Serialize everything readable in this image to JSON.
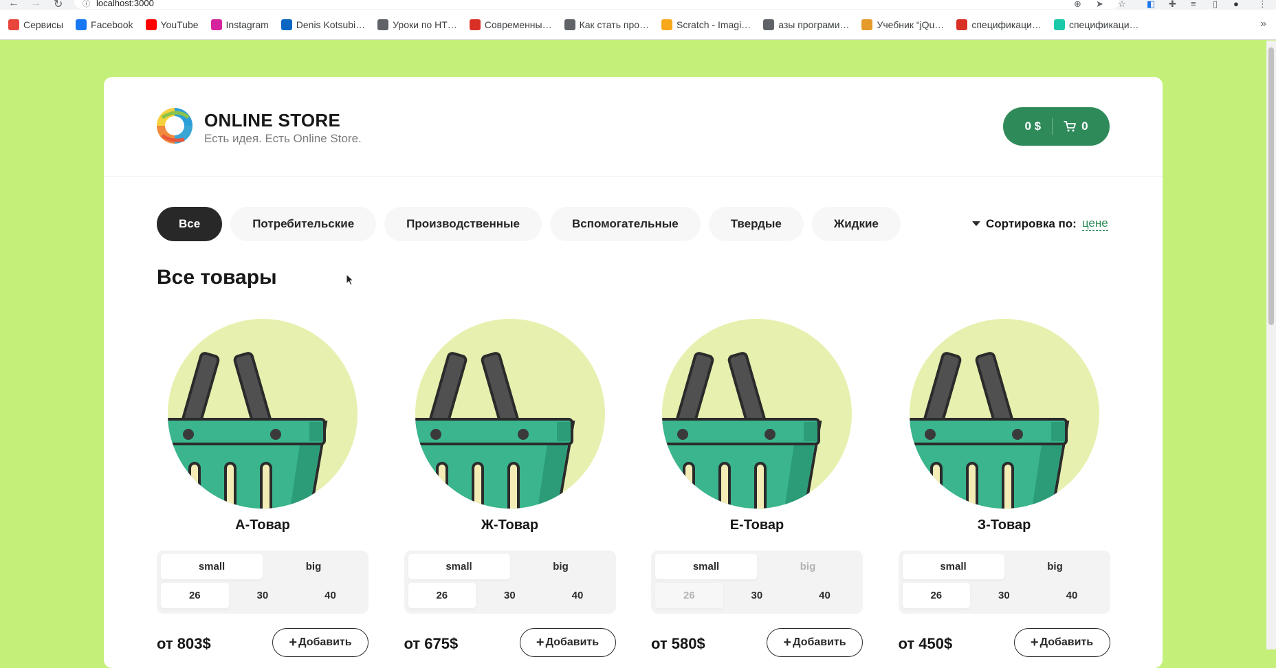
{
  "browser": {
    "url": "localhost:3000",
    "bookmarks": [
      {
        "label": "Сервисы",
        "icon": "apps-grid-icon",
        "color": "#e8453c"
      },
      {
        "label": "Facebook",
        "icon": "facebook-icon",
        "color": "#1877f2"
      },
      {
        "label": "YouTube",
        "icon": "youtube-icon",
        "color": "#ff0000"
      },
      {
        "label": "Instagram",
        "icon": "instagram-icon",
        "color": "#d6249f"
      },
      {
        "label": "Denis Kotsubi…",
        "icon": "linkedin-icon",
        "color": "#0a66c2"
      },
      {
        "label": "Уроки по HT…",
        "icon": "chat-icon",
        "color": "#5f6368"
      },
      {
        "label": "Современны…",
        "icon": "mobile-icon",
        "color": "#d93025"
      },
      {
        "label": "Как стать про…",
        "icon": "globe-icon",
        "color": "#5f6368"
      },
      {
        "label": "Scratch - Imagi…",
        "icon": "scratch-icon",
        "color": "#f7a81b"
      },
      {
        "label": "азы програми…",
        "icon": "globe-icon",
        "color": "#5f6368"
      },
      {
        "label": "Учебник “jQu…",
        "icon": "jquery-icon",
        "color": "#e49b2a"
      },
      {
        "label": "спецификаци…",
        "icon": "cube-icon",
        "color": "#d93025"
      },
      {
        "label": "спецификаци…",
        "icon": "bookmark-icon",
        "color": "#1bc9a8"
      }
    ]
  },
  "store": {
    "name": "ONLINE STORE",
    "tagline": "Есть идея. Есть Online Store.",
    "cart_total": "0 $",
    "cart_count": "0"
  },
  "categories": [
    {
      "label": "Все",
      "active": true
    },
    {
      "label": "Потребительские",
      "active": false
    },
    {
      "label": "Производственные",
      "active": false
    },
    {
      "label": "Вспомогательные",
      "active": false
    },
    {
      "label": "Твердые",
      "active": false
    },
    {
      "label": "Жидкие",
      "active": false
    }
  ],
  "sort": {
    "label": "Сортировка по:",
    "value": "цене"
  },
  "page_title": "Все товары",
  "add_label": "Добавить",
  "colors": {
    "background": "#c4f07a",
    "accent": "#2f8a5a",
    "dark": "#282828"
  },
  "products": [
    {
      "name": "А-Товар",
      "price": "от 803$",
      "types": [
        {
          "label": "small",
          "state": "selected"
        },
        {
          "label": "big",
          "state": "normal"
        }
      ],
      "sizes": [
        {
          "label": "26",
          "state": "selected"
        },
        {
          "label": "30",
          "state": "normal"
        },
        {
          "label": "40",
          "state": "normal"
        }
      ]
    },
    {
      "name": "Ж-Товар",
      "price": "от 675$",
      "types": [
        {
          "label": "small",
          "state": "selected"
        },
        {
          "label": "big",
          "state": "normal"
        }
      ],
      "sizes": [
        {
          "label": "26",
          "state": "selected"
        },
        {
          "label": "30",
          "state": "normal"
        },
        {
          "label": "40",
          "state": "normal"
        }
      ]
    },
    {
      "name": "Е-Товар",
      "price": "от 580$",
      "types": [
        {
          "label": "small",
          "state": "selected"
        },
        {
          "label": "big",
          "state": "disabled"
        }
      ],
      "sizes": [
        {
          "label": "26",
          "state": "disabled-selected"
        },
        {
          "label": "30",
          "state": "normal"
        },
        {
          "label": "40",
          "state": "normal"
        }
      ]
    },
    {
      "name": "З-Товар",
      "price": "от 450$",
      "types": [
        {
          "label": "small",
          "state": "selected"
        },
        {
          "label": "big",
          "state": "normal"
        }
      ],
      "sizes": [
        {
          "label": "26",
          "state": "selected"
        },
        {
          "label": "30",
          "state": "normal"
        },
        {
          "label": "40",
          "state": "normal"
        }
      ]
    }
  ]
}
